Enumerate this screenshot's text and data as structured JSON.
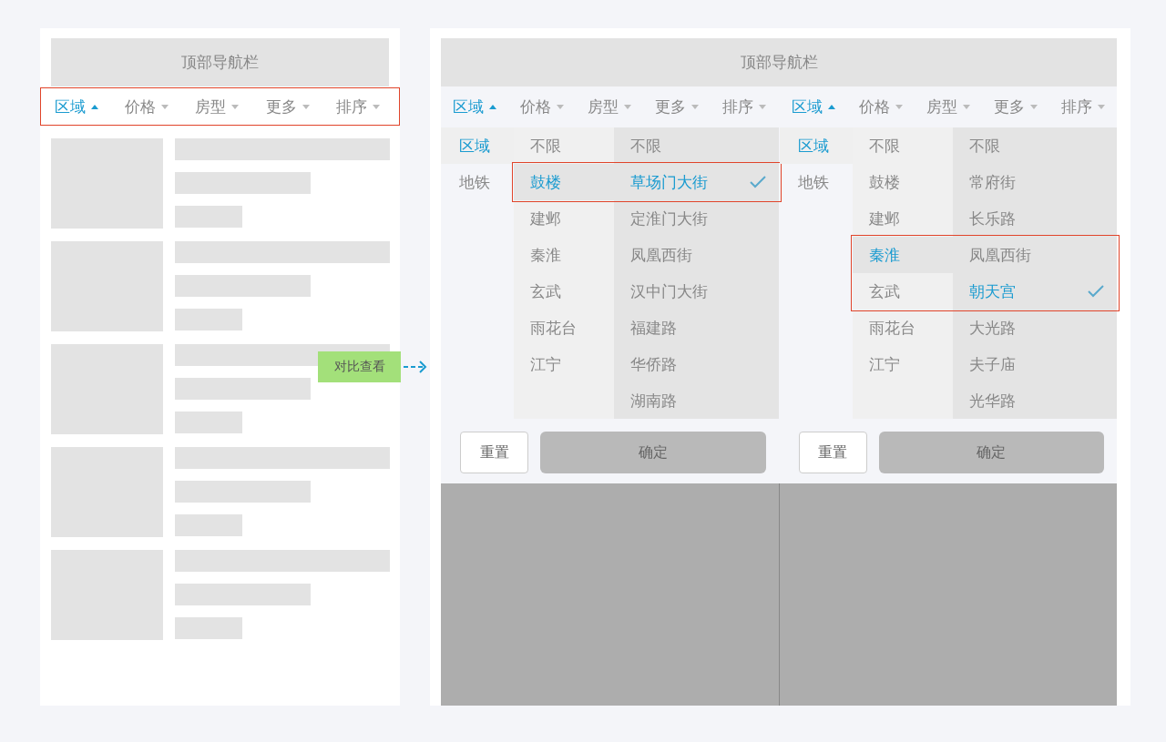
{
  "left_phone": {
    "nav_title": "顶部导航栏",
    "filter_tabs": [
      {
        "label": "区域",
        "selected": true
      },
      {
        "label": "价格",
        "selected": false
      },
      {
        "label": "房型",
        "selected": false
      },
      {
        "label": "更多",
        "selected": false
      },
      {
        "label": "排序",
        "selected": false
      }
    ],
    "listing": [
      {
        "kind": "placeholder"
      },
      {
        "kind": "placeholder"
      },
      {
        "kind": "placeholder"
      },
      {
        "kind": "placeholder"
      },
      {
        "kind": "placeholder"
      }
    ]
  },
  "compare_label": "对比查看",
  "right_phone": {
    "nav_title": "顶部导航栏",
    "panels": [
      {
        "filter_tabs": [
          {
            "label": "区域",
            "selected": true
          },
          {
            "label": "价格",
            "selected": false
          },
          {
            "label": "房型",
            "selected": false
          },
          {
            "label": "更多",
            "selected": false
          },
          {
            "label": "排序",
            "selected": false
          }
        ],
        "categories": [
          {
            "label": "区域",
            "selected": true
          },
          {
            "label": "地铁",
            "selected": false
          }
        ],
        "districts": [
          {
            "label": "不限",
            "selected": false
          },
          {
            "label": "鼓楼",
            "selected": true
          },
          {
            "label": "建邺",
            "selected": false
          },
          {
            "label": "秦淮",
            "selected": false
          },
          {
            "label": "玄武",
            "selected": false
          },
          {
            "label": "雨花台",
            "selected": false
          },
          {
            "label": "江宁",
            "selected": false
          }
        ],
        "streets": [
          {
            "label": "不限",
            "selected": false
          },
          {
            "label": "草场门大街",
            "selected": true
          },
          {
            "label": "定淮门大街",
            "selected": false
          },
          {
            "label": "凤凰西街",
            "selected": false
          },
          {
            "label": "汉中门大街",
            "selected": false
          },
          {
            "label": "福建路",
            "selected": false
          },
          {
            "label": "华侨路",
            "selected": false
          },
          {
            "label": "湖南路",
            "selected": false
          }
        ],
        "reset": "重置",
        "confirm": "确定"
      },
      {
        "filter_tabs": [
          {
            "label": "区域",
            "selected": true
          },
          {
            "label": "价格",
            "selected": false
          },
          {
            "label": "房型",
            "selected": false
          },
          {
            "label": "更多",
            "selected": false
          },
          {
            "label": "排序",
            "selected": false
          }
        ],
        "categories": [
          {
            "label": "区域",
            "selected": true
          },
          {
            "label": "地铁",
            "selected": false
          }
        ],
        "districts": [
          {
            "label": "不限",
            "selected": false
          },
          {
            "label": "鼓楼",
            "selected": false
          },
          {
            "label": "建邺",
            "selected": false
          },
          {
            "label": "秦淮",
            "selected": true
          },
          {
            "label": "玄武",
            "selected": false
          },
          {
            "label": "雨花台",
            "selected": false
          },
          {
            "label": "江宁",
            "selected": false
          }
        ],
        "streets": [
          {
            "label": "不限",
            "selected": false
          },
          {
            "label": "常府街",
            "selected": false
          },
          {
            "label": "长乐路",
            "selected": false
          },
          {
            "label": "凤凰西街",
            "selected": false
          },
          {
            "label": "朝天宫",
            "selected": true
          },
          {
            "label": "大光路",
            "selected": false
          },
          {
            "label": "夫子庙",
            "selected": false
          },
          {
            "label": "光华路",
            "selected": false
          }
        ],
        "reset": "重置",
        "confirm": "确定"
      }
    ]
  }
}
